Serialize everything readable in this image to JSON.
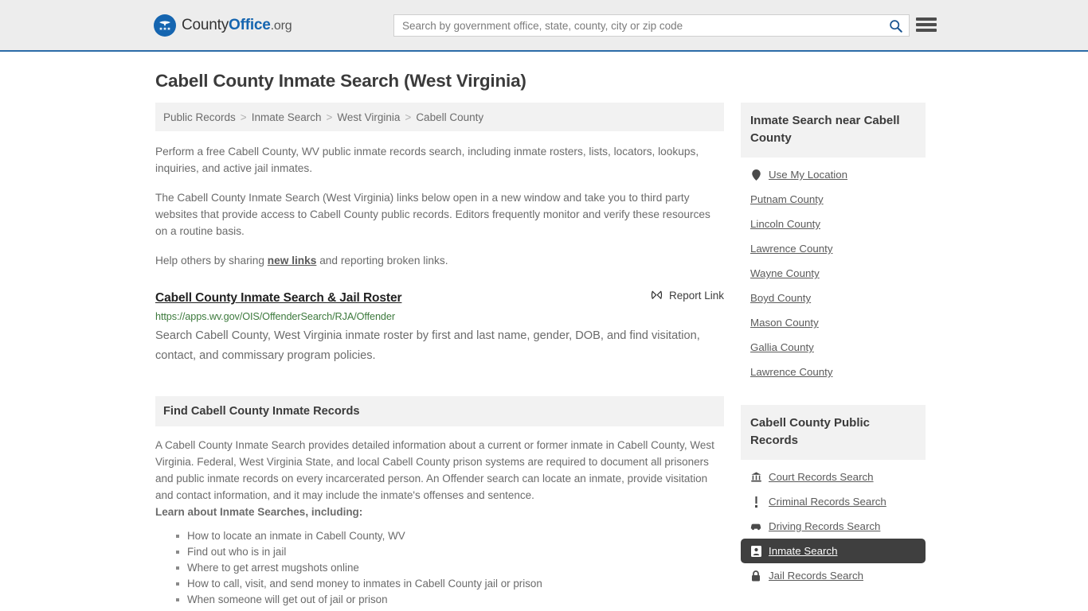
{
  "header": {
    "brand": {
      "part1": "County",
      "part2": "Office",
      "part3": ".org",
      "logo_icon": "eagle-shield-icon"
    },
    "search": {
      "placeholder": "Search by government office, state, county, city or zip code",
      "value": "",
      "search_icon": "search-icon"
    },
    "menu_icon": "hamburger-menu-icon"
  },
  "main": {
    "page_title": "Cabell County Inmate Search (West Virginia)",
    "breadcrumb": [
      {
        "label": "Public Records"
      },
      {
        "label": "Inmate Search"
      },
      {
        "label": "West Virginia"
      },
      {
        "label": "Cabell County"
      }
    ],
    "breadcrumb_separator": ">",
    "intro1": "Perform a free Cabell County, WV public inmate records search, including inmate rosters, lists, locators, lookups, inquiries, and active jail inmates.",
    "intro2": "The Cabell County Inmate Search (West Virginia) links below open in a new window and take you to third party websites that provide access to Cabell County public records. Editors frequently monitor and verify these resources on a routine basis.",
    "intro3_pre": "Help others by sharing ",
    "intro3_link": "new links",
    "intro3_post": " and reporting broken links.",
    "result": {
      "title": "Cabell County Inmate Search & Jail Roster",
      "report_label": "Report Link",
      "report_icon": "broken-link-icon",
      "url": "https://apps.wv.gov/OIS/OffenderSearch/RJA/Offender",
      "description": "Search Cabell County, West Virginia inmate roster by first and last name, gender, DOB, and find visitation, contact, and commissary program policies."
    },
    "panel": {
      "heading": "Find Cabell County Inmate Records",
      "body": "A Cabell County Inmate Search provides detailed information about a current or former inmate in Cabell County, West Virginia. Federal, West Virginia State, and local Cabell County prison systems are required to document all prisoners and public inmate records on every incarcerated person. An Offender search can locate an inmate, provide visitation and contact information, and it may include the inmate's offenses and sentence.",
      "learn_heading": "Learn about Inmate Searches, including:",
      "learn_items": [
        "How to locate an inmate in Cabell County, WV",
        "Find out who is in jail",
        "Where to get arrest mugshots online",
        "How to call, visit, and send money to inmates in Cabell County jail or prison",
        "When someone will get out of jail or prison"
      ]
    }
  },
  "sidebar": {
    "nearby": {
      "heading": "Inmate Search near Cabell County",
      "items": [
        {
          "label": "Use My Location",
          "icon": "map-pin-icon"
        },
        {
          "label": "Putnam County",
          "icon": ""
        },
        {
          "label": "Lincoln County",
          "icon": ""
        },
        {
          "label": "Lawrence County",
          "icon": ""
        },
        {
          "label": "Wayne County",
          "icon": ""
        },
        {
          "label": "Boyd County",
          "icon": ""
        },
        {
          "label": "Mason County",
          "icon": ""
        },
        {
          "label": "Gallia County",
          "icon": ""
        },
        {
          "label": "Lawrence County",
          "icon": ""
        }
      ]
    },
    "records": {
      "heading": "Cabell County Public Records",
      "items": [
        {
          "label": "Court Records Search",
          "icon": "courthouse-icon",
          "active": false
        },
        {
          "label": "Criminal Records Search",
          "icon": "exclamation-icon",
          "active": false
        },
        {
          "label": "Driving Records Search",
          "icon": "car-icon",
          "active": false
        },
        {
          "label": "Inmate Search",
          "icon": "id-card-icon",
          "active": true
        },
        {
          "label": "Jail Records Search",
          "icon": "lock-icon",
          "active": false
        }
      ]
    }
  },
  "colors": {
    "brand_blue": "#1565b0",
    "header_bg": "#ededed",
    "header_border": "#2c6ca8",
    "panel_bg": "#f2f2f2",
    "url_green": "#3d7a3d",
    "active_bg": "#3f3f3f",
    "text": "#6b6b6b"
  }
}
